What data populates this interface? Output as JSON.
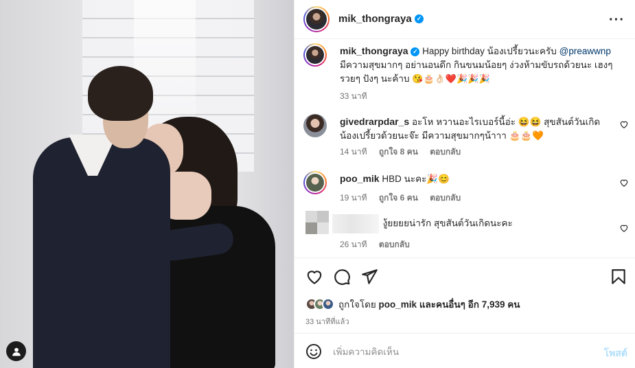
{
  "post": {
    "author": "mik_thongraya",
    "verified_mark": "✓",
    "more_icon": "more-horizontal-icon"
  },
  "caption": {
    "username": "mik_thongraya",
    "text_1": "Happy birthday น้องเปรี้ยวนะครับ",
    "mention": "@preawwnp",
    "text_2": "มีความสุขมากๆ อย่านอนดึก กินขนมน้อยๆ ง่วงห้ามขับรถด้วยนะ เฮงๆ รวยๆ ปังๆ นะค้าบ",
    "emojis": "😘🎂👌🏻❤️🎉🎉🎉",
    "time": "33 นาที"
  },
  "comments": [
    {
      "username": "givedrarpdar_s",
      "text": "อะโห หวานอะไรเบอร์นี้อ่ะ 😆😆 สุขสันต์วันเกิดน้องเปรี้ยวด้วยนะจ๊ะ มีความสุขมากๆน้าาา 🎂🎂🧡",
      "time": "14 นาที",
      "likes": "ถูกใจ 8 คน",
      "reply": "ตอบกลับ"
    },
    {
      "username": "poo_mik",
      "text": "HBD นะคะ🎉😊",
      "time": "19 นาที",
      "likes": "ถูกใจ 6 คน",
      "reply": "ตอบกลับ"
    },
    {
      "text": "งู้ยยยยน่ารัก สุขสันต์วันเกิดนะคะ",
      "time": "26 นาที",
      "reply": "ตอบกลับ"
    }
  ],
  "likes": {
    "prefix": "ถูกใจโดย",
    "user": "poo_mik",
    "middle": "และคนอื่นๆ อีก",
    "count": "7,939",
    "suffix": "คน"
  },
  "posted_ago": "33 นาทีที่แล้ว",
  "composer": {
    "placeholder": "เพิ่มความคิดเห็น",
    "post_label": "โพสต์"
  },
  "colors": {
    "text": "#262626",
    "muted": "#737373",
    "link": "#00376b",
    "verified": "#0095f6",
    "post_button_disabled": "#b2dffc",
    "border": "#efefef"
  }
}
